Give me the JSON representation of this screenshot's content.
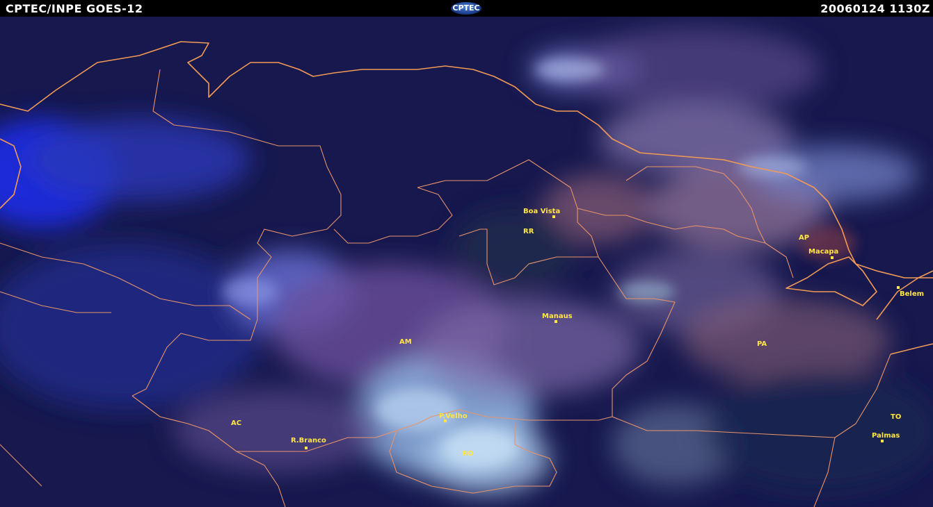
{
  "header": {
    "source_label": "CPTEC/INPE  GOES-12",
    "logo_text": "CPTEC",
    "timestamp": "20060124  1130Z"
  },
  "map": {
    "states": {
      "rr": "RR",
      "ap": "AP",
      "am": "AM",
      "pa": "PA",
      "ac": "AC",
      "ro": "RO",
      "to": "TO"
    },
    "cities": {
      "boa_vista": "Boa Vista",
      "macapa": "Macapa",
      "belem": "Belem",
      "manaus": "Manaus",
      "p_velho": "P.Velho",
      "r_branco": "R.Branco",
      "palmas": "Palmas"
    },
    "colors": {
      "label": "#ffe640",
      "coastline": "#f39a55",
      "background": "#14164a"
    }
  }
}
